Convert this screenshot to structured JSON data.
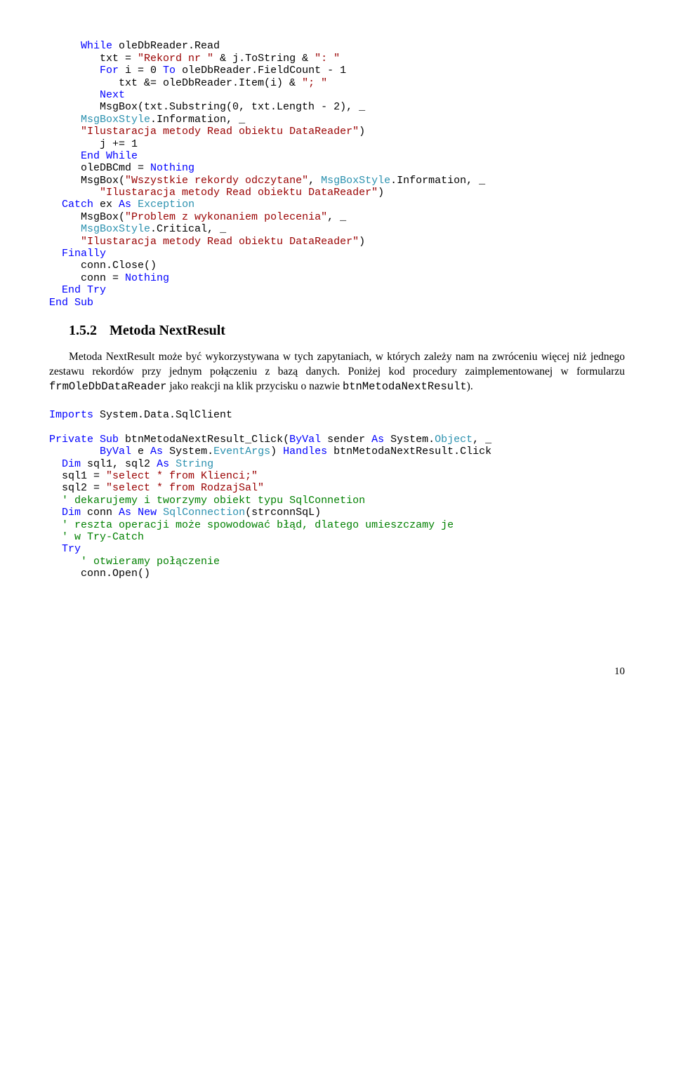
{
  "code1": {
    "l01a": "     ",
    "l01b": "While",
    "l01c": " oleDbReader.Read",
    "l02a": "        txt = ",
    "l02b": "\"Rekord nr \"",
    "l02c": " & j.ToString & ",
    "l02d": "\": \"",
    "l03a": "        ",
    "l03b": "For",
    "l03c": " i = 0 ",
    "l03d": "To",
    "l03e": " oleDbReader.FieldCount - 1",
    "l04a": "           txt &= oleDbReader.Item(i) & ",
    "l04b": "\"; \"",
    "l05a": "        ",
    "l05b": "Next",
    "l06a": "        MsgBox(txt.Substring(0, txt.Length - 2), _",
    "l07a": "     ",
    "l07b": "MsgBoxStyle",
    "l07c": ".Information, _",
    "l08a": "     ",
    "l08b": "\"Ilustaracja metody Read obiektu DataReader\"",
    "l08c": ")",
    "l09a": "        j += 1",
    "l10a": "     ",
    "l10b": "End",
    "l10c": " ",
    "l10d": "While",
    "l11a": "     oleDBCmd = ",
    "l11b": "Nothing",
    "l12a": "     MsgBox(",
    "l12b": "\"Wszystkie rekordy odczytane\"",
    "l12c": ", ",
    "l12d": "MsgBoxStyle",
    "l12e": ".Information, _",
    "l13a": "        ",
    "l13b": "\"Ilustaracja metody Read obiektu DataReader\"",
    "l13c": ")",
    "l14a": "  ",
    "l14b": "Catch",
    "l14c": " ex ",
    "l14d": "As",
    "l14e": " ",
    "l14f": "Exception",
    "l15a": "     MsgBox(",
    "l15b": "\"Problem z wykonaniem polecenia\"",
    "l15c": ", _",
    "l16a": "     ",
    "l16b": "MsgBoxStyle",
    "l16c": ".Critical, _",
    "l17a": "     ",
    "l17b": "\"Ilustaracja metody Read obiektu DataReader\"",
    "l17c": ")",
    "l18a": "  ",
    "l18b": "Finally",
    "l19a": "     conn.Close()",
    "l20a": "     conn = ",
    "l20b": "Nothing",
    "l21a": "  ",
    "l21b": "End",
    "l21c": " ",
    "l21d": "Try",
    "l22a": "End",
    "l22b": " ",
    "l22c": "Sub"
  },
  "section": {
    "num": "1.5.2",
    "title": "Metoda NextResult"
  },
  "para1a": "Metoda NextResult może być wykorzystywana w tych zapytaniach, w których zależy nam na zwróceniu więcej niż jednego zestawu rekordów przy jednym połączeniu z bazą danych. Poniżej kod procedury zaimplementowanej w formularzu ",
  "para1b": "frmOleDbDataReader",
  "para1c": " jako reakcji na klik przycisku o nazwie ",
  "para1d": "btnMetodaNextResult",
  "para1e": ").",
  "code2": {
    "l01a": "Imports",
    "l01b": " System.Data.SqlClient",
    "spacer1": " ",
    "l02a": "Private",
    "l02b": " ",
    "l02c": "Sub",
    "l02d": " btnMetodaNextResult_Click(",
    "l02e": "ByVal",
    "l02f": " sender ",
    "l02g": "As",
    "l02h": " System.",
    "l02i": "Object",
    "l02j": ", _",
    "l03a": "        ",
    "l03b": "ByVal",
    "l03c": " e ",
    "l03d": "As",
    "l03e": " System.",
    "l03f": "EventArgs",
    "l03g": ") ",
    "l03h": "Handles",
    "l03i": " btnMetodaNextResult.Click",
    "l04a": "  ",
    "l04b": "Dim",
    "l04c": " sql1, sql2 ",
    "l04d": "As",
    "l04e": " ",
    "l04f": "String",
    "l05a": "  sql1 = ",
    "l05b": "\"select * from Klienci;\"",
    "l06a": "  sql2 = ",
    "l06b": "\"select * from RodzajSal\"",
    "l07a": "  ",
    "l07b": "' dekarujemy i tworzymy obiekt typu SqlConnetion",
    "l08a": "  ",
    "l08b": "Dim",
    "l08c": " conn ",
    "l08d": "As",
    "l08e": " ",
    "l08f": "New",
    "l08g": " ",
    "l08h": "SqlConnection",
    "l08i": "(strconnSqL)",
    "l09a": "  ",
    "l09b": "' reszta operacji może spowodować błąd, dlatego umieszczamy je",
    "l10a": "  ",
    "l10b": "' w Try-Catch",
    "l11a": "  ",
    "l11b": "Try",
    "l12a": "     ",
    "l12b": "' otwieramy połączenie",
    "l13a": "     conn.Open()"
  },
  "pageNo": "10"
}
